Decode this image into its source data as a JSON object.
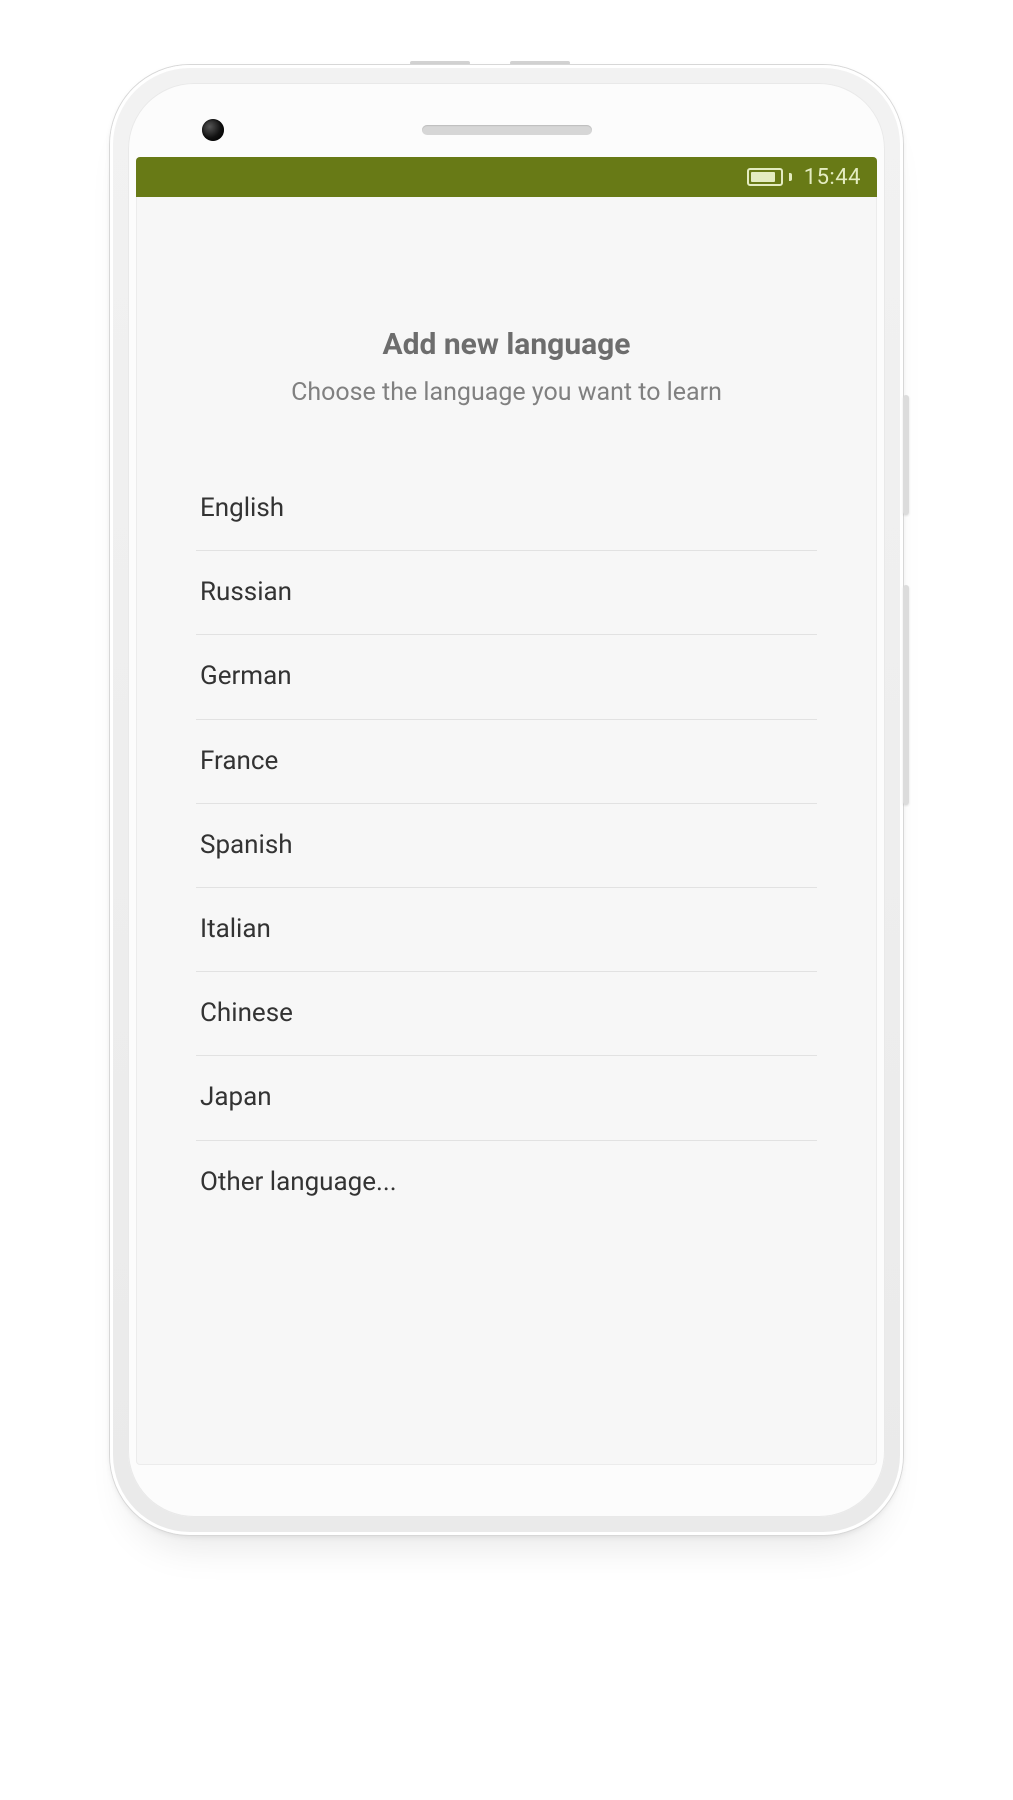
{
  "status_bar": {
    "time": "15:44"
  },
  "header": {
    "title": "Add new language",
    "subtitle": "Choose the language you want to learn"
  },
  "languages": {
    "items": [
      {
        "label": "English"
      },
      {
        "label": "Russian"
      },
      {
        "label": "German"
      },
      {
        "label": "France"
      },
      {
        "label": "Spanish"
      },
      {
        "label": "Italian"
      },
      {
        "label": "Chinese"
      },
      {
        "label": "Japan"
      },
      {
        "label": "Other language..."
      }
    ]
  },
  "colors": {
    "status_bar_bg": "#687a16",
    "status_bar_fg": "#e4ecc1",
    "screen_bg": "#f7f7f7",
    "title_color": "#6d6d6d",
    "subtitle_color": "#808080",
    "item_color": "#333333",
    "divider": "#e2e2e2"
  }
}
